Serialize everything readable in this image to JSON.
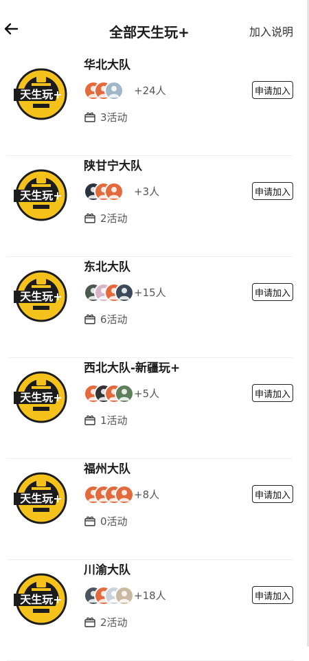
{
  "header": {
    "back_icon": "arrow-left-icon",
    "title": "全部天生玩+",
    "join_help": "加入说明"
  },
  "logo_text": "天生玩+",
  "colors": {
    "logo_yellow": "#f5c21b",
    "logo_dark": "#1c1c1c"
  },
  "teams": [
    {
      "name": "华北大队",
      "members": "+24人",
      "activities": "3活动",
      "apply": "申请加入",
      "avatars": [
        "#e36a3c",
        "#e36a3c",
        "#9fb7c8"
      ]
    },
    {
      "name": "陕甘宁大队",
      "members": "+3人",
      "activities": "2活动",
      "apply": "申请加入",
      "avatars": [
        "#2a3340",
        "#e36a3c",
        "#e36a3c"
      ]
    },
    {
      "name": "东北大队",
      "members": "+15人",
      "activities": "6活动",
      "apply": "申请加入",
      "avatars": [
        "#4b5a4f",
        "#d8b4c8",
        "#e36a3c",
        "#3a4a5a"
      ]
    },
    {
      "name": "西北大队-新疆玩+",
      "members": "+5人",
      "activities": "1活动",
      "apply": "申请加入",
      "avatars": [
        "#e36a3c",
        "#333333",
        "#e36a3c",
        "#5d7f5a"
      ]
    },
    {
      "name": "福州大队",
      "members": "+8人",
      "activities": "0活动",
      "apply": "申请加入",
      "avatars": [
        "#e36a3c",
        "#e36a3c",
        "#e36a3c",
        "#e36a3c"
      ]
    },
    {
      "name": "川渝大队",
      "members": "+18人",
      "activities": "2活动",
      "apply": "申请加入",
      "avatars": [
        "#4a5560",
        "#e36a3c",
        "#c9d3dc",
        "#c9b9a0"
      ]
    }
  ]
}
